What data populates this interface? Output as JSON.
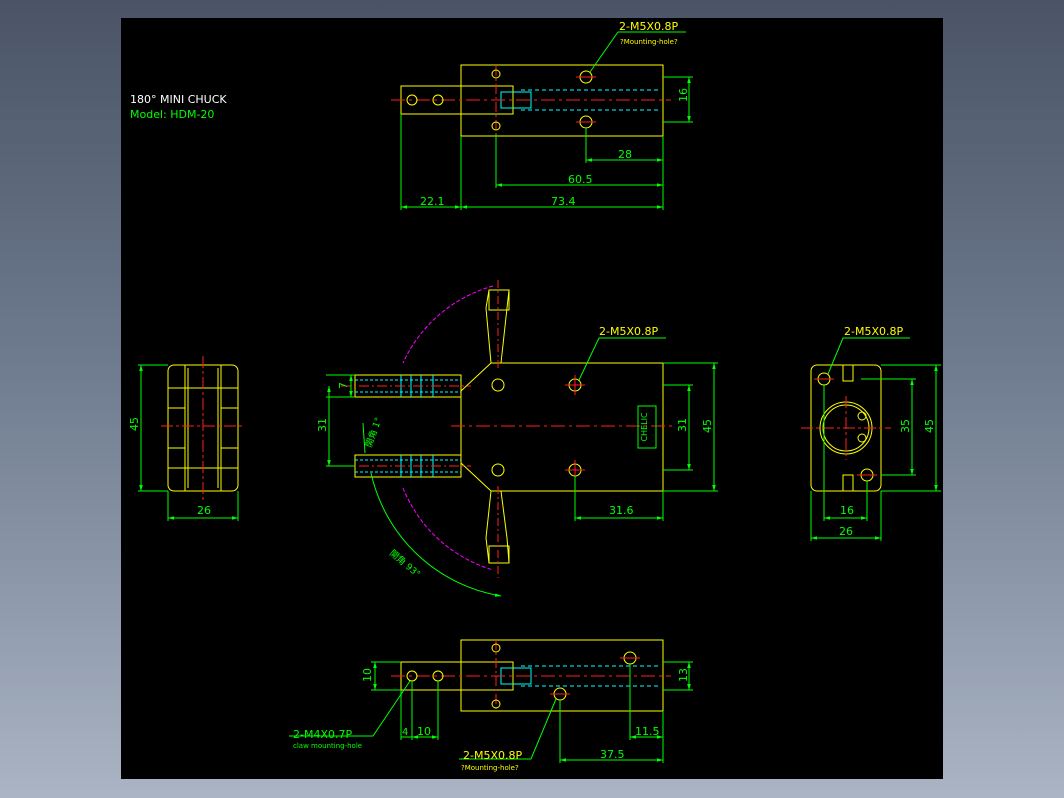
{
  "title_block": {
    "title": "180° MINI CHUCK",
    "model": "Model:  HDM-20"
  },
  "top_view": {
    "callout_thread": "2-M5X0.8P",
    "callout_note": "?Mounting-hole?",
    "dim_height": "16",
    "dim_a": "28",
    "dim_b": "60.5",
    "dim_c": "22.1",
    "dim_d": "73.4"
  },
  "front_view": {
    "callout_thread": "2-M5X0.8P",
    "dim_gap": "7",
    "dim_open": "31",
    "dim_inner": "31",
    "dim_outer": "45",
    "dim_bottom": "31.6",
    "angle_small": "開角 1°",
    "angle_large": "開角 93°",
    "nameplate": "CHELIC"
  },
  "left_view": {
    "dim_height": "45",
    "dim_width": "26"
  },
  "right_view": {
    "callout_thread": "2-M5X0.8P",
    "dim_inner": "35",
    "dim_outer": "45",
    "dim_a": "16",
    "dim_b": "26"
  },
  "bottom_view": {
    "dim_height_left": "10",
    "dim_height_right": "13",
    "dim_a": "4",
    "dim_b": "10",
    "dim_c": "11.5",
    "dim_d": "37.5",
    "callout_jaw": "2-M4X0.7P",
    "callout_jaw_note": "claw mounting-hole",
    "callout_thread": "2-M5X0.8P",
    "callout_note": "?Mounting-hole?"
  },
  "colors": {
    "background": "#000000",
    "outline": "#ffff00",
    "dimension": "#00ff00",
    "centerline": "#ff2020",
    "hidden": "#00ffff",
    "arc": "#ff00ff",
    "text": "#ffffff"
  }
}
